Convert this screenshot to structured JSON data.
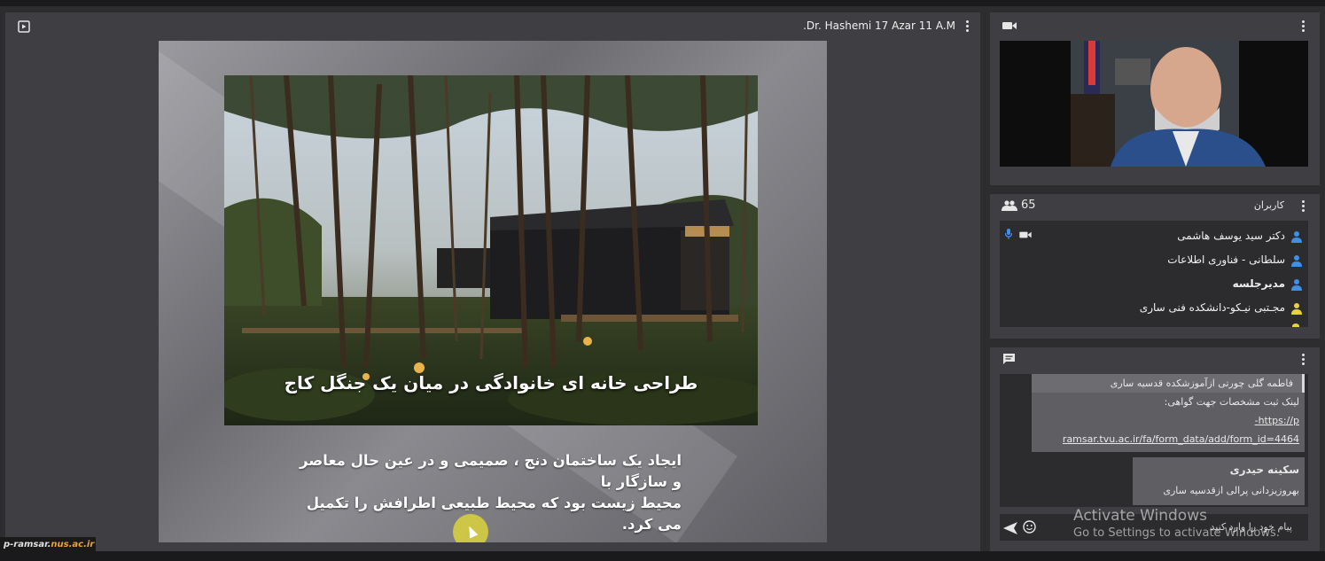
{
  "presenter_label": ".Dr. Hashemi 17 Azar 11 A.M",
  "slide": {
    "title": "طراحی خانه ای خانوادگی در میان یک جنگل کاج",
    "body_line1": "ایجاد یک ساختمان دنج ، صمیمی و در عین حال معاصر و سازگار با",
    "body_line2": "محیط زیست بود که محیط طبیعی اطرافش را تکمیل می کرد."
  },
  "users": {
    "count": "65",
    "title": "کاربران",
    "list": [
      {
        "name": "دکتر سید یوسف هاشمی",
        "icon_color": "#3f8ee8",
        "bold": false,
        "mic": true,
        "cam": true
      },
      {
        "name": "سلطانی - فناوری اطلاعات",
        "icon_color": "#3f8ee8",
        "bold": false,
        "mic": false,
        "cam": false
      },
      {
        "name": "مدیرجلسه",
        "icon_color": "#3f8ee8",
        "bold": true,
        "mic": false,
        "cam": false
      },
      {
        "name": "مجـتبی نیـکو-دانشکده فنی ساری",
        "icon_color": "#e8d23f",
        "bold": false,
        "mic": false,
        "cam": false
      }
    ]
  },
  "chat": {
    "msg1_top": "فاطمه گلی چورتی ازآموزشکده قدسیه ساری",
    "msg1_line2": "لینک ثبت مشخصات جهت گواهی:",
    "msg1_link_a": "https://p-",
    "msg1_link_b": "ramsar.tvu.ac.ir/fa/form_data/add/form_id=4464",
    "msg2_name": "سکینه حیدری",
    "msg2_text": "بهروزیزدانی پرالی ازقدسیه ساری",
    "input_placeholder": "پیام خود را وارد کنید"
  },
  "watermark": {
    "part_a": "p-ramsar.",
    "part_b": "nus.ac.ir"
  },
  "system_overlay": {
    "line1": "Activate Windows",
    "line2": "Go to Settings to activate Windows."
  },
  "icons": {
    "share": "screen-share-icon",
    "video": "video-camera-icon",
    "users": "people-icon",
    "chat": "chat-bubble-icon",
    "send": "send-icon",
    "emoji": "smiley-icon"
  },
  "colors": {
    "accent_blue": "#3f8ee8",
    "accent_yellow": "#e8d23f",
    "panel": "#3f3f43",
    "background": "#2d2d30"
  }
}
